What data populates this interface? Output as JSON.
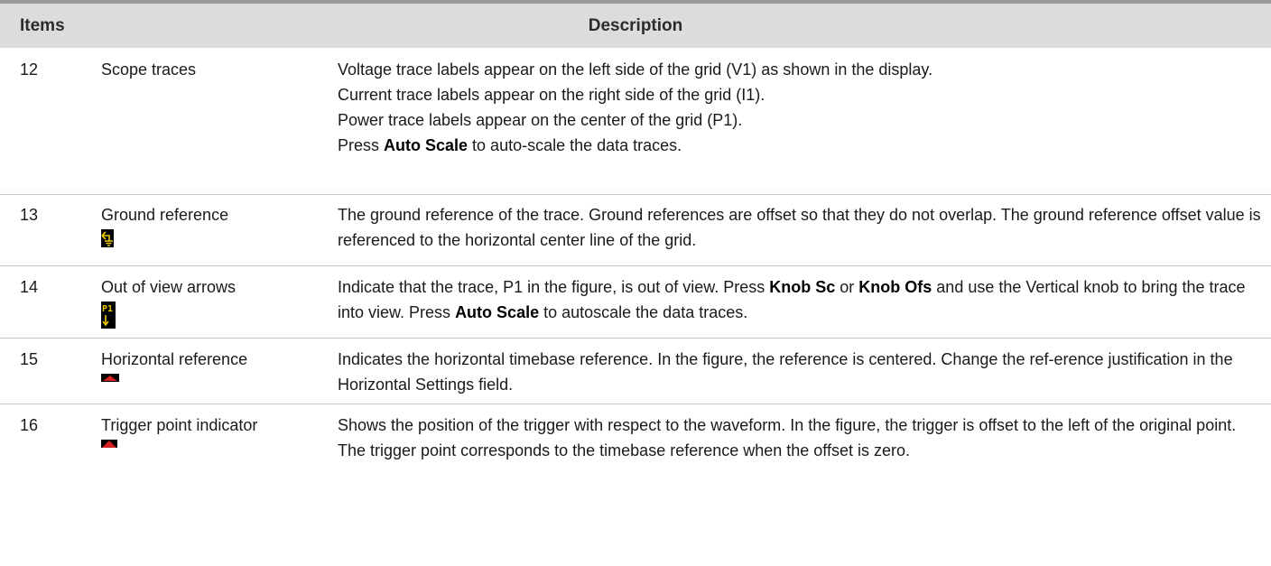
{
  "header": {
    "items": "Items",
    "description": "Description"
  },
  "rows": [
    {
      "num": "12",
      "item": "Scope traces",
      "lines": [
        "Voltage trace labels appear on the left side of the grid (V1) as shown in the display.",
        "Current trace labels appear on the right side of the grid (I1).",
        "Power trace labels appear on the center of the grid (P1)."
      ],
      "last_pre": "Press ",
      "last_bold": "Auto Scale",
      "last_post": " to auto-scale the data traces."
    },
    {
      "num": "13",
      "item": "Ground reference",
      "icon": "ground-reference-icon",
      "text": "The ground reference of the trace. Ground references are offset so that they do not overlap. The ground reference offset value is referenced to the horizontal center line of the grid."
    },
    {
      "num": "14",
      "item": "Out of view arrows",
      "icon": "out-of-view-arrow-icon",
      "icon_label": "P1",
      "seg1": "Indicate that the trace, P1 in the figure, is out of view. Press ",
      "bold1": "Knob Sc",
      "seg2": " or ",
      "bold2": "Knob Ofs",
      "seg3": " and use the Vertical knob to bring the trace into view. Press ",
      "bold3": "Auto Scale",
      "seg4": " to autoscale the data traces."
    },
    {
      "num": "15",
      "item": "Horizontal reference",
      "icon": "horizontal-reference-icon",
      "text": "Indicates the horizontal timebase reference. In the figure, the reference is centered. Change the ref-erence justification in the Horizontal Settings field."
    },
    {
      "num": "16",
      "item": "Trigger point indicator",
      "icon": "trigger-point-icon",
      "text": "Shows the position of the trigger with respect to the waveform. In the figure, the trigger is offset to the left of the original point. The trigger point corresponds to the timebase reference when the offset is zero."
    }
  ],
  "colors": {
    "header_bg": "#dcdcdc",
    "icon_yellow": "#e8c800",
    "icon_red": "#d42020",
    "icon_bg": "#000000"
  }
}
